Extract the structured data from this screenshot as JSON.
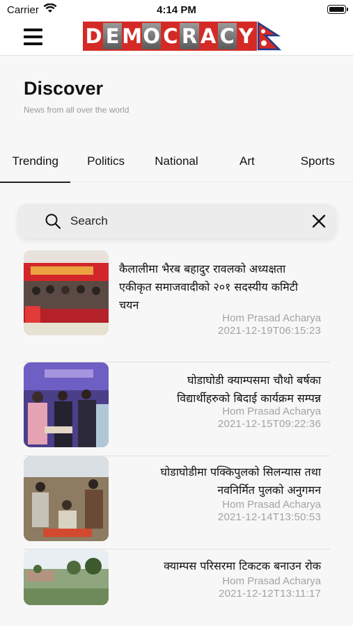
{
  "status_bar": {
    "carrier": "Carrier",
    "time": "4:14 PM"
  },
  "navbar": {
    "logo_letters": [
      "D",
      "E",
      "M",
      "O",
      "C",
      "R",
      "A",
      "C",
      "Y"
    ],
    "logo_text": "DEMOCRACY",
    "accent_color": "#d42a26"
  },
  "header": {
    "title": "Discover",
    "subtitle": "News from all over the world"
  },
  "tabs": [
    {
      "label": "Trending",
      "active": true
    },
    {
      "label": "Politics",
      "active": false
    },
    {
      "label": "National",
      "active": false
    },
    {
      "label": "Art",
      "active": false
    },
    {
      "label": "Sports",
      "active": false
    }
  ],
  "search": {
    "placeholder": "Search",
    "value": ""
  },
  "news": [
    {
      "headline": "कैलालीमा भैरब बहादुर रावलको अध्यक्षता एकीकृत समाजवादीको २०१ सदस्यीय कमिटी चयन",
      "author": "Hom Prasad Acharya",
      "date": "2021-12-19T06:15:23"
    },
    {
      "headline": "घोडाघोडी क्याम्पसमा चौथो बर्षका विद्यार्थीहरुको बिदाई कार्यक्रम सम्पन्न",
      "author": "Hom Prasad Acharya",
      "date": "2021-12-15T09:22:36"
    },
    {
      "headline": "घोडाघोडीमा पक्किपुलको सिलन्यास तथा नवनिर्मित पुलको अनुगमन",
      "author": "Hom Prasad Acharya",
      "date": "2021-12-14T13:50:53"
    },
    {
      "headline": "क्याम्पस परिसरमा  टिकटक बनाउन रोक",
      "author": "Hom Prasad Acharya",
      "date": "2021-12-12T13:11:17"
    }
  ]
}
